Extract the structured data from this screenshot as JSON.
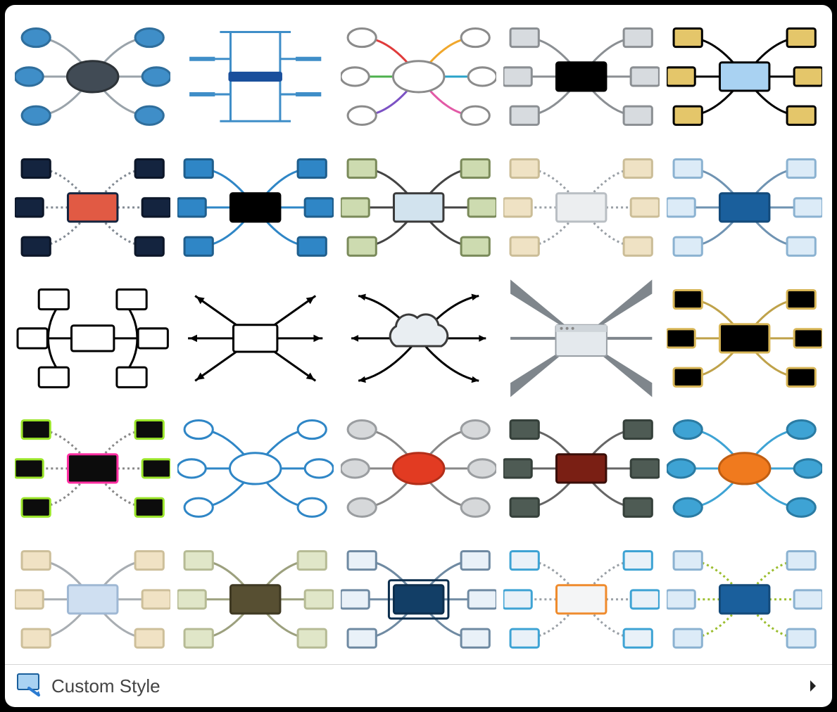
{
  "footer": {
    "custom_style_label": "Custom Style"
  },
  "styles": [
    {
      "id": "blue-ovals-dark-center",
      "type": "oval",
      "center": "#414b55",
      "leaf": "#3f8ec8",
      "conn": "#9aa3aa",
      "line": "solid",
      "cBorder": "#2d3338",
      "lBorder": "#2f6e9c"
    },
    {
      "id": "thin-blue-lines",
      "type": "lines",
      "center": "#1a4f9c",
      "leaf": "#3f8ec8",
      "conn": "#3f8ec8"
    },
    {
      "id": "white-ovals-rainbow",
      "type": "oval",
      "center": "#ffffff",
      "leaf": "#ffffff",
      "conn": "rainbow",
      "cBorder": "#8b8b8b",
      "lBorder": "#8b8b8b",
      "rounded": true
    },
    {
      "id": "grey-black-center",
      "type": "rect",
      "center": "#000000",
      "leaf": "#d7dbdf",
      "conn": "#8b8f93",
      "line": "solid",
      "cBorder": "#000",
      "lBorder": "#8b8f93"
    },
    {
      "id": "gold-blue-center",
      "type": "rect",
      "center": "#a9d2f2",
      "leaf": "#e4c66a",
      "conn": "#000000",
      "line": "solid",
      "cBorder": "#000",
      "lBorder": "#000"
    },
    {
      "id": "navy-orange-center",
      "type": "rect",
      "center": "#e15a44",
      "leaf": "#14243f",
      "conn": "#828a93",
      "line": "dotted",
      "cBorder": "#14243f",
      "lBorder": "#0c1628"
    },
    {
      "id": "blue-black-center",
      "type": "rect",
      "center": "#000000",
      "leaf": "#2f86c6",
      "conn": "#2f86c6",
      "line": "solid",
      "cBorder": "#000",
      "lBorder": "#1f5e8c"
    },
    {
      "id": "olive-green",
      "type": "rect",
      "center": "#d2e3ee",
      "leaf": "#cddbb0",
      "conn": "#444",
      "line": "solid",
      "cBorder": "#3a3a3a",
      "lBorder": "#7a8a5a"
    },
    {
      "id": "beige-dotted",
      "type": "rect",
      "center": "#eceef0",
      "leaf": "#efe2c4",
      "conn": "#9aa0a6",
      "line": "dotted",
      "cBorder": "#b9bec3",
      "lBorder": "#cbbd97"
    },
    {
      "id": "light-blue-navy-center",
      "type": "rect",
      "center": "#1a5f9c",
      "leaf": "#dcebf7",
      "conn": "#6f93b2",
      "line": "solid",
      "cBorder": "#134a7a",
      "lBorder": "#8bb2d1"
    },
    {
      "id": "white-arc",
      "type": "arc",
      "center": "#ffffff",
      "leaf": "#ffffff",
      "conn": "#000",
      "cBorder": "#000",
      "lBorder": "#000"
    },
    {
      "id": "arrows-out",
      "type": "arrows",
      "center": "#ffffff",
      "conn": "#000",
      "cBorder": "#000"
    },
    {
      "id": "cloud-arrows",
      "type": "cloud",
      "center": "#e9eef2",
      "conn": "#000",
      "cBorder": "#3b3b3b"
    },
    {
      "id": "window-spikes",
      "type": "spikes",
      "center": "#e4e9ed",
      "conn": "#7f868c",
      "cBorder": "#9aa0a6"
    },
    {
      "id": "black-gold-border",
      "type": "rect",
      "center": "#000000",
      "leaf": "#000000",
      "conn": "#bfa24a",
      "line": "solid",
      "cBorder": "#d7b556",
      "lBorder": "#d7b556"
    },
    {
      "id": "black-lime-pink",
      "type": "rect",
      "center": "#0c0c0c",
      "leaf": "#0c0c0c",
      "conn": "#888",
      "line": "dotted",
      "cBorder": "#ff2fa2",
      "lBorder": "#9be52a"
    },
    {
      "id": "blue-outline-ovals",
      "type": "oval",
      "center": "#ffffff",
      "leaf": "#ffffff",
      "conn": "#2f86c6",
      "line": "solid",
      "cBorder": "#2f86c6",
      "lBorder": "#2f86c6",
      "rounded": true
    },
    {
      "id": "grey-red-oval",
      "type": "oval",
      "center": "#e23b22",
      "leaf": "#d6d8da",
      "conn": "#888",
      "line": "solid",
      "cBorder": "#b22e19",
      "lBorder": "#9a9da0",
      "rounded": true
    },
    {
      "id": "slate-maroon",
      "type": "rect",
      "center": "#7a1f14",
      "leaf": "#4e5b54",
      "conn": "#666",
      "line": "solid",
      "cBorder": "#3a0e08",
      "lBorder": "#35403a"
    },
    {
      "id": "cyan-orange-oval",
      "type": "oval",
      "center": "#f07a1e",
      "leaf": "#3ea3d4",
      "conn": "#3ea3d4",
      "line": "solid",
      "cBorder": "#c15e12",
      "lBorder": "#2a7ba3",
      "rounded": true
    },
    {
      "id": "tan-lightblue",
      "type": "rect",
      "center": "#cfdff1",
      "leaf": "#f0e2c4",
      "conn": "#a8adb2",
      "line": "solid",
      "cBorder": "#9fb8d4",
      "lBorder": "#cdbf9a"
    },
    {
      "id": "olive-brown-center",
      "type": "rect",
      "center": "#574f32",
      "leaf": "#e0e6c8",
      "conn": "#9ca07e",
      "line": "solid",
      "cBorder": "#3e3822",
      "lBorder": "#b6bb95"
    },
    {
      "id": "white-navy-inset",
      "type": "rect",
      "center": "#123e66",
      "leaf": "#e9f1f8",
      "conn": "#6f8aa2",
      "line": "solid",
      "cBorder": "#0d2f4e",
      "lBorder": "#6f8aa2",
      "inset": true
    },
    {
      "id": "blue-orange-border",
      "type": "rect",
      "center": "#f4f5f6",
      "leaf": "#e9f1f8",
      "conn": "#9aa0a6",
      "line": "dotted",
      "cBorder": "#ef8b2d",
      "lBorder": "#3ea3d4"
    },
    {
      "id": "blue-lime-dotted",
      "type": "rect",
      "center": "#1a5f9c",
      "leaf": "#dcebf7",
      "conn": "#9bbd2e",
      "line": "dotted",
      "cBorder": "#134a7a",
      "lBorder": "#8bb2d1"
    }
  ]
}
